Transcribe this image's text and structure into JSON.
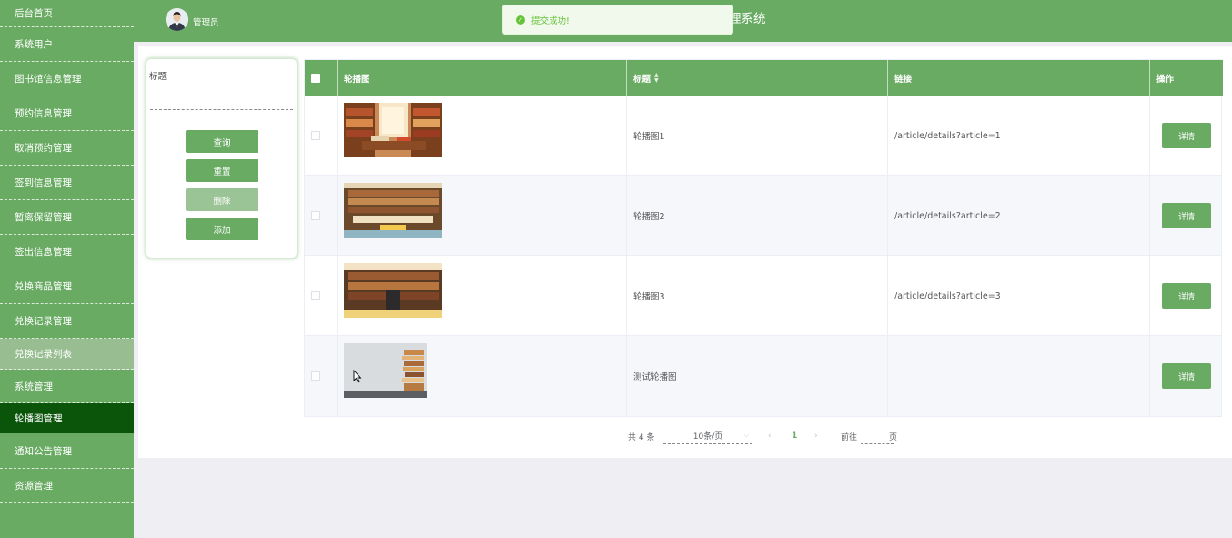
{
  "sidebar": {
    "items": [
      {
        "label": "后台首页"
      },
      {
        "label": "系统用户"
      },
      {
        "label": "图书馆信息管理"
      },
      {
        "label": "预约信息管理"
      },
      {
        "label": "取消预约管理"
      },
      {
        "label": "签到信息管理"
      },
      {
        "label": "暂离保留管理"
      },
      {
        "label": "签出信息管理"
      },
      {
        "label": "兑换商品管理"
      },
      {
        "label": "兑换记录管理"
      },
      {
        "label": "兑换记录列表"
      },
      {
        "label": "系统管理"
      },
      {
        "label": "轮播图管理"
      },
      {
        "label": "通知公告管理"
      },
      {
        "label": "资源管理"
      }
    ],
    "hover_index": 10,
    "active_index": 12
  },
  "header": {
    "user_name": "管理员",
    "title": "理系统"
  },
  "toast": {
    "message": "提交成功!"
  },
  "search": {
    "label": "标题",
    "value": "",
    "buttons": {
      "query": "查询",
      "reset": "重置",
      "delete": "删除",
      "add": "添加"
    }
  },
  "table": {
    "columns": {
      "image": "轮播图",
      "title": "标题",
      "link": "链接",
      "action": "操作"
    },
    "rows": [
      {
        "title": "轮播图1",
        "link": "/article/details?article=1",
        "action": "详情"
      },
      {
        "title": "轮播图2",
        "link": "/article/details?article=2",
        "action": "详情"
      },
      {
        "title": "轮播图3",
        "link": "/article/details?article=3",
        "action": "详情"
      },
      {
        "title": "测试轮播图",
        "link": "",
        "action": "详情"
      }
    ]
  },
  "pagination": {
    "total_text": "共 4 条",
    "page_size": "10条/页",
    "current_page": "1",
    "goto_prefix": "前往",
    "goto_suffix": "页"
  },
  "colors": {
    "primary": "#6aab64",
    "active": "#0b550b",
    "hover": "#97bd91"
  }
}
